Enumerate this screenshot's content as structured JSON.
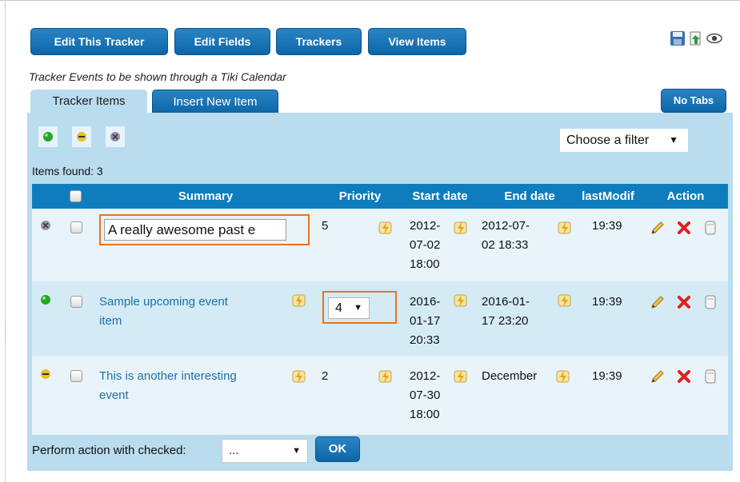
{
  "toolbar": {
    "edit_tracker": "Edit This Tracker",
    "edit_fields": "Edit Fields",
    "trackers": "Trackers",
    "view_items": "View Items"
  },
  "caption": "Tracker Events to be shown through a Tiki Calendar",
  "tabs": {
    "tracker_items": "Tracker Items",
    "insert_new": "Insert New Item",
    "no_tabs": "No Tabs"
  },
  "filter": {
    "label": "Choose a filter",
    "arrow": "▼"
  },
  "items_found": "Items found: 3",
  "table": {
    "headers": {
      "summary": "Summary",
      "priority": "Priority",
      "start_date": "Start date",
      "end_date": "End date",
      "last_modif": "lastModif",
      "action": "Action"
    },
    "rows": [
      {
        "status": "closed",
        "summary": "A really awesome  past e",
        "priority": "5",
        "start_1": "2012-",
        "start_2": "07-02",
        "start_3": "18:00",
        "end_1": "2012-07-",
        "end_2": "02 18:33",
        "last_modif": "19:39"
      },
      {
        "status": "open",
        "summary_1": "Sample upcoming event",
        "summary_2": "item",
        "priority": "4",
        "start_1": "2016-",
        "start_2": "01-17",
        "start_3": "20:33",
        "end_1": "2016-01-",
        "end_2": "17 23:20",
        "last_modif": "19:39"
      },
      {
        "status": "pending",
        "summary_1": "This is another interesting",
        "summary_2": "event",
        "priority": "2",
        "start_1": "2012-",
        "start_2": "07-30",
        "start_3": "18:00",
        "end_1": "December",
        "last_modif": "19:39"
      }
    ]
  },
  "footer": {
    "label": "Perform action with checked:",
    "select_value": "...",
    "arrow": "▼",
    "ok": "OK"
  },
  "colors": {
    "accent": "#0f7dbd",
    "panel": "#b9dcee",
    "highlight": "#e8731c",
    "delete": "#e02020"
  }
}
